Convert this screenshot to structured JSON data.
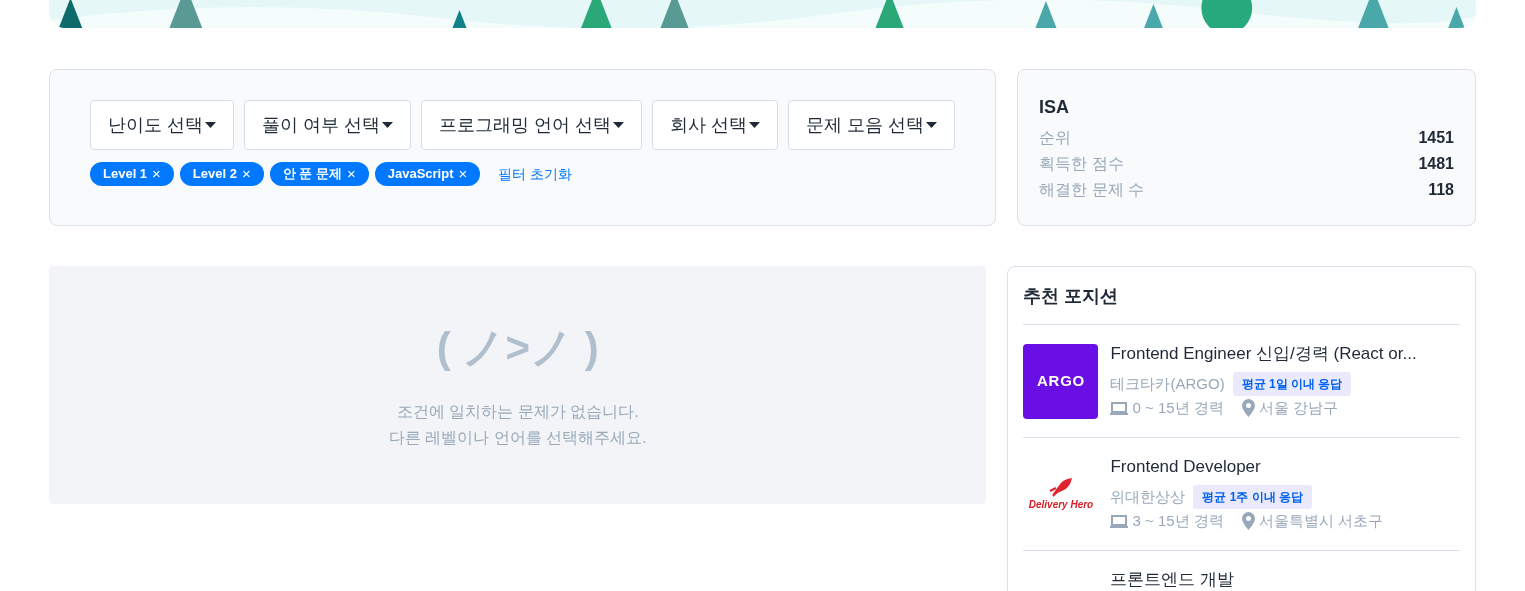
{
  "filters": {
    "dropdowns": [
      {
        "label": "난이도 선택"
      },
      {
        "label": "풀이 여부 선택"
      },
      {
        "label": "프로그래밍 언어 선택"
      },
      {
        "label": "회사 선택"
      },
      {
        "label": "문제 모음 선택"
      }
    ],
    "chips": [
      {
        "label": "Level 1",
        "remove": "×"
      },
      {
        "label": "Level 2",
        "remove": "×"
      },
      {
        "label": "안 푼 문제",
        "remove": "×"
      },
      {
        "label": "JavaScript",
        "remove": "×"
      }
    ],
    "reset": "필터 초기화"
  },
  "profile": {
    "name": "ISA",
    "stats": [
      {
        "label": "순위",
        "value": "1451"
      },
      {
        "label": "획득한 점수",
        "value": "1481"
      },
      {
        "label": "해결한 문제 수",
        "value": "118"
      }
    ]
  },
  "empty_state": {
    "emoticon": "( ノ>ノ )",
    "lines": [
      "조건에 일치하는 문제가 없습니다.",
      "다른 레벨이나 언어를 선택해주세요."
    ]
  },
  "positions": {
    "title": "추천 포지션",
    "items": [
      {
        "kind": "argo",
        "logo_text": "ARGO",
        "title": "Frontend Engineer 신입/경력 (React or...",
        "company": "테크타카(ARGO)",
        "badge": "평균 1일 이내 응답",
        "experience": "0 ~ 15년 경력",
        "location": "서울 강남구"
      },
      {
        "kind": "hero",
        "logo_text": "Delivery Hero",
        "title": "Frontend Developer",
        "company": "위대한상상",
        "badge": "평균 1주 이내 응답",
        "experience": "3 ~ 15년 경력",
        "location": "서울특별시 서초구"
      },
      {
        "kind": "plain",
        "title": "프론트엔드 개발"
      }
    ]
  }
}
